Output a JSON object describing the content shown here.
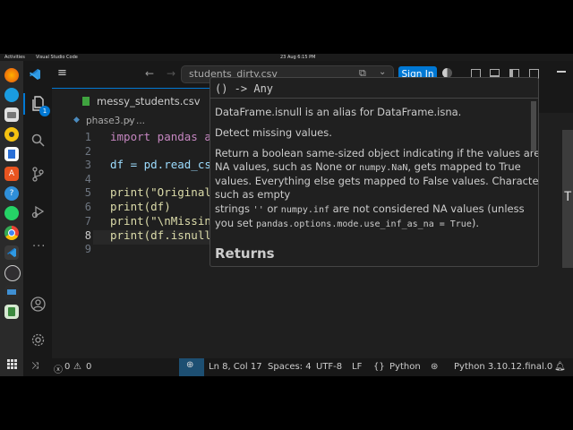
{
  "gnome": {
    "activities": "Activities",
    "app": "Visual Studio Code",
    "date": "23 Aug  6:15 PM"
  },
  "dock": {
    "items": [
      "firefox-icon",
      "files-icon",
      "rhythmbox-icon",
      "writer-icon",
      "app-center-icon",
      "help-icon",
      "whatsapp-icon",
      "chrome-icon",
      "vscode-icon",
      "obs-icon",
      "virtualbox-icon",
      "trash-icon",
      "show-apps-icon"
    ]
  },
  "titlebar": {
    "search": "students_dirty.csv",
    "signin": "Sign In"
  },
  "activity": {
    "badge": "1"
  },
  "tab": {
    "label": "messy_students.csv"
  },
  "breadcrumb": {
    "file": "phase3.py",
    "more": "..."
  },
  "editor": {
    "lines": [
      {
        "n": "1",
        "text": "import pandas as"
      },
      {
        "n": "2",
        "text": ""
      },
      {
        "n": "3",
        "text": "df = pd.read_csv"
      },
      {
        "n": "4",
        "text": ""
      },
      {
        "n": "5",
        "text": "print(\"Original "
      },
      {
        "n": "6",
        "text": "print(df)"
      },
      {
        "n": "7",
        "text": "print(\"\\nMissing"
      },
      {
        "n": "8",
        "text": "print(df.isnull("
      },
      {
        "n": "9",
        "text": ""
      }
    ],
    "right_edge_char": "T"
  },
  "hover": {
    "signature": "() -> Any",
    "line1": "DataFrame.isnull is an alias for DataFrame.isna.",
    "line2": "Detect missing values.",
    "p3_a": "Return a boolean same-sized object indicating if the values are NA.",
    "p3_b": "NA values, such as None or ",
    "p3_code1": "numpy.NaN",
    "p3_c": ", gets mapped to True",
    "p3_d": "values. Everything else gets mapped to False values. Characters",
    "p3_e": "such as empty",
    "p3_f": "strings ",
    "p3_code2": "''",
    "p3_g": " or ",
    "p3_code3": "numpy.inf",
    "p3_h": " are not considered NA values (unless",
    "p3_i": "you set ",
    "p3_code4": "pandas.options.mode.use_inf_as_na = True",
    "p3_j": ").",
    "returns": "Returns"
  },
  "status": {
    "errors": "0",
    "warnings": "0",
    "position": "Ln 8, Col 17",
    "spaces": "Spaces: 4",
    "encoding": "UTF-8",
    "eol": "LF",
    "language": "Python",
    "interpreter": "Python 3.10.12.final.0"
  },
  "colors": {
    "keyword": "#c586c0",
    "string": "#ce9178",
    "function": "#dcdcaa",
    "accent": "#0078d4"
  }
}
